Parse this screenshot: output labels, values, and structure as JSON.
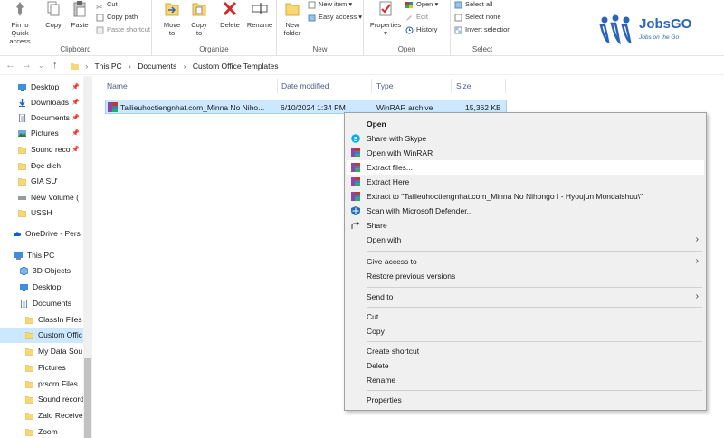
{
  "ribbon": {
    "clipboard": {
      "label": "Clipboard",
      "pin": "Pin to Quick access",
      "copy": "Copy",
      "paste": "Paste",
      "cut": "Cut",
      "copy_path": "Copy path",
      "paste_shortcut": "Paste shortcut"
    },
    "organize": {
      "label": "Organize",
      "move_to": "Move to",
      "copy_to": "Copy to",
      "delete": "Delete",
      "rename": "Rename"
    },
    "new": {
      "label": "New",
      "new_folder": "New folder",
      "new_item": "New item",
      "easy_access": "Easy access"
    },
    "open": {
      "label": "Open",
      "properties": "Properties",
      "open": "Open",
      "edit": "Edit",
      "history": "History"
    },
    "select": {
      "label": "Select",
      "select_all": "Select all",
      "select_none": "Select none",
      "invert": "Invert selection"
    }
  },
  "logo": {
    "name": "JobsGO",
    "tagline": "Jobs on the Go",
    "color": "#2a64b8"
  },
  "breadcrumb": [
    "This PC",
    "Documents",
    "Custom Office Templates"
  ],
  "sidebar": {
    "items": [
      {
        "label": "Desktop",
        "icon": "desktop-icon",
        "pinned": true
      },
      {
        "label": "Downloads",
        "icon": "download-icon",
        "pinned": true
      },
      {
        "label": "Documents",
        "icon": "documents-icon",
        "pinned": true
      },
      {
        "label": "Pictures",
        "icon": "pictures-icon",
        "pinned": true
      },
      {
        "label": "Sound reco",
        "icon": "folder-icon",
        "pinned": true
      },
      {
        "label": "Đọc dịch",
        "icon": "folder-icon"
      },
      {
        "label": "GIA SƯ",
        "icon": "folder-icon"
      },
      {
        "label": "New Volume (",
        "icon": "drive-icon"
      },
      {
        "label": "USSH",
        "icon": "folder-icon"
      },
      {
        "label": "OneDrive - Pers",
        "icon": "onedrive-icon"
      },
      {
        "label": "This PC",
        "icon": "this-pc-icon"
      },
      {
        "label": "3D Objects",
        "icon": "3d-objects-icon"
      },
      {
        "label": "Desktop",
        "icon": "desktop-icon"
      },
      {
        "label": "Documents",
        "icon": "documents-icon"
      },
      {
        "label": "ClassIn Files",
        "icon": "folder-icon"
      },
      {
        "label": "Custom Offic",
        "icon": "folder-icon",
        "selected": true
      },
      {
        "label": "My Data Sou",
        "icon": "folder-icon"
      },
      {
        "label": "Pictures",
        "icon": "folder-icon"
      },
      {
        "label": "prscrn Files",
        "icon": "folder-icon"
      },
      {
        "label": "Sound record",
        "icon": "folder-icon"
      },
      {
        "label": "Zalo Receive",
        "icon": "folder-icon"
      },
      {
        "label": "Zoom",
        "icon": "folder-icon"
      }
    ]
  },
  "columns": {
    "name": "Name",
    "date": "Date modified",
    "type": "Type",
    "size": "Size"
  },
  "file": {
    "name": "Tailieuhoctiengnhat.com_Minna No Niho...",
    "date": "6/10/2024 1:34 PM",
    "type": "WinRAR archive",
    "size": "15,362 KB"
  },
  "context_menu": {
    "open": "Open",
    "share_skype": "Share with Skype",
    "open_winrar": "Open with WinRAR",
    "extract_files": "Extract files...",
    "extract_here": "Extract Here",
    "extract_to": "Extract to \"Tailieuhoctiengnhat.com_Minna No Nihongo I - Hyoujun Mondaishuu\\\"",
    "scan_defender": "Scan with Microsoft Defender...",
    "share": "Share",
    "open_with": "Open with",
    "give_access": "Give access to",
    "restore_versions": "Restore previous versions",
    "send_to": "Send to",
    "cut": "Cut",
    "copy": "Copy",
    "create_shortcut": "Create shortcut",
    "delete": "Delete",
    "rename": "Rename",
    "properties": "Properties"
  },
  "colors": {
    "selection": "#cce8ff",
    "folder": "#f8d775",
    "accent": "#0078d7"
  }
}
